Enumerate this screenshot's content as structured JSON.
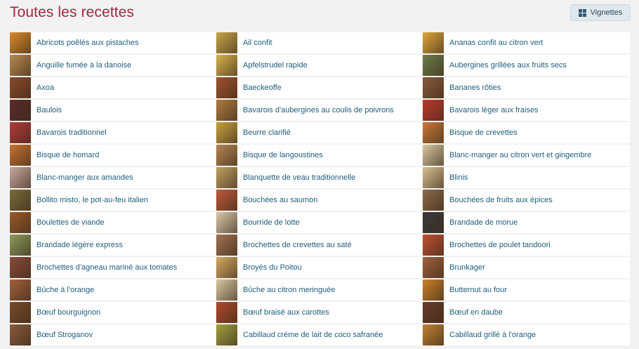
{
  "header": {
    "title": "Toutes les recettes",
    "view_button_label": "Vignettes",
    "view_button_icon": "grid-icon"
  },
  "recipes": [
    {
      "label": "Abricots poêlés aux pistaches",
      "thumb": "#d98a2a"
    },
    {
      "label": "Ail confit",
      "thumb": "#c9a54a"
    },
    {
      "label": "Ananas confit au citron vert",
      "thumb": "#e0a63a"
    },
    {
      "label": "Anguille fumée à la danoise",
      "thumb": "#b98a4e"
    },
    {
      "label": "Apfelstrudel rapide",
      "thumb": "#d8b24c"
    },
    {
      "label": "Aubergines grillées aux fruits secs",
      "thumb": "#6e7d4a"
    },
    {
      "label": "Axoa",
      "thumb": "#8a4a2a"
    },
    {
      "label": "Baeckeoffe",
      "thumb": "#a0522d"
    },
    {
      "label": "Bananes rôties",
      "thumb": "#8a5a3a"
    },
    {
      "label": "Baulois",
      "thumb": "#5a2a2a"
    },
    {
      "label": "Bavarois d'aubergines au coulis de poivrons",
      "thumb": "#b07a40"
    },
    {
      "label": "Bavarois léger aux fraises",
      "thumb": "#c0392b"
    },
    {
      "label": "Bavarois traditionnel",
      "thumb": "#b23a3a"
    },
    {
      "label": "Beurre clarifié",
      "thumb": "#c8a040"
    },
    {
      "label": "Bisque de crevettes",
      "thumb": "#c97a3a"
    },
    {
      "label": "Bisque de homard",
      "thumb": "#c8722e"
    },
    {
      "label": "Bisque de langoustines",
      "thumb": "#b78550"
    },
    {
      "label": "Blanc-manger au citron vert et gingembre",
      "thumb": "#d8c8a0"
    },
    {
      "label": "Blanc-manger aux amandes",
      "thumb": "#c8a8a0"
    },
    {
      "label": "Blanquette de veau traditionnelle",
      "thumb": "#c0a060"
    },
    {
      "label": "Blinis",
      "thumb": "#d8c090"
    },
    {
      "label": "Bollito misto, le pot-au-feu italien",
      "thumb": "#7a6a3a"
    },
    {
      "label": "Bouchées au saumon",
      "thumb": "#c05a3a"
    },
    {
      "label": "Bouchées de fruits aux épices",
      "thumb": "#8a6a4a"
    },
    {
      "label": "Boulettes de viande",
      "thumb": "#9a5a2a"
    },
    {
      "label": "Bourride de lotte",
      "thumb": "#d8c8a8"
    },
    {
      "label": "Brandade de morue",
      "thumb": "#3a3a3a"
    },
    {
      "label": "Brandade légère express",
      "thumb": "#8a9a5a"
    },
    {
      "label": "Brochettes de crevettes au saté",
      "thumb": "#a07050"
    },
    {
      "label": "Brochettes de poulet tandoori",
      "thumb": "#c05030"
    },
    {
      "label": "Brochettes d'agneau mariné aux tomates",
      "thumb": "#8a4a3a"
    },
    {
      "label": "Broyés du Poitou",
      "thumb": "#d8a860"
    },
    {
      "label": "Brunkager",
      "thumb": "#a0603a"
    },
    {
      "label": "Bûche à l'orange",
      "thumb": "#a0603a"
    },
    {
      "label": "Bûche au citron meringuée",
      "thumb": "#d8c8a0"
    },
    {
      "label": "Butternut au four",
      "thumb": "#c8802a"
    },
    {
      "label": "Bœuf bourguignon",
      "thumb": "#7a4a2a"
    },
    {
      "label": "Bœuf braisé aux carottes",
      "thumb": "#b04a2a"
    },
    {
      "label": "Bœuf en daube",
      "thumb": "#6a3a2a"
    },
    {
      "label": "Bœuf Stroganov",
      "thumb": "#8a5a3a"
    },
    {
      "label": "Cabillaud crème de lait de coco safranée",
      "thumb": "#a0a040"
    },
    {
      "label": "Cabillaud grillé à l'orange",
      "thumb": "#c08030"
    }
  ]
}
